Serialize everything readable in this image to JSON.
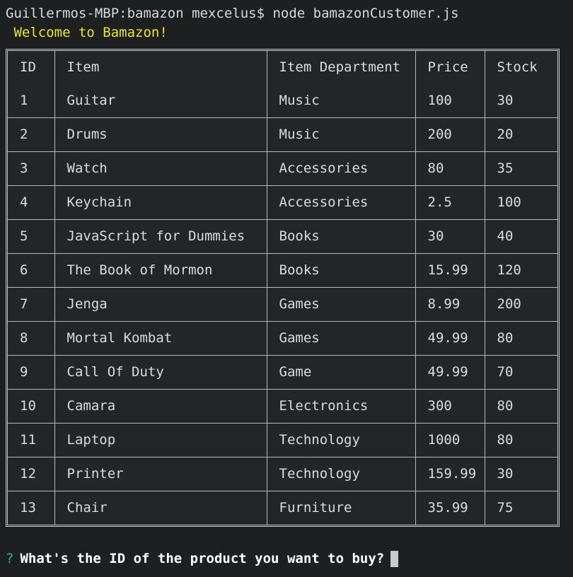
{
  "terminal": {
    "command_line": "Guillermos-MBP:bamazon mexcelus$ node bamazonCustomer.js",
    "welcome_message": " Welcome to Bamazon!",
    "prompt": {
      "marker": "?",
      "question": "What's the ID of the product you want to buy?",
      "input_value": "",
      "cursor": "block"
    },
    "colors": {
      "background": "#1d1f21",
      "foreground": "#d8d8d8",
      "welcome": "#e8e82c",
      "prompt_marker": "#2bbc8a",
      "prompt_text": "#ffffff",
      "table_border": "#b9b9b9",
      "cursor": "#c9c9c9"
    }
  },
  "table": {
    "columns": [
      "ID",
      "Item",
      "Item Department",
      "Price",
      "Stock"
    ],
    "rows": [
      [
        "1",
        "Guitar",
        "Music",
        "100",
        "30"
      ],
      [
        "2",
        "Drums",
        "Music",
        "200",
        "20"
      ],
      [
        "3",
        "Watch",
        "Accessories",
        "80",
        "35"
      ],
      [
        "4",
        "Keychain",
        "Accessories",
        "2.5",
        "100"
      ],
      [
        "5",
        "JavaScript for Dummies",
        "Books",
        "30",
        "40"
      ],
      [
        "6",
        "The Book of Mormon",
        "Books",
        "15.99",
        "120"
      ],
      [
        "7",
        "Jenga",
        "Games",
        "8.99",
        "200"
      ],
      [
        "8",
        "Mortal Kombat",
        "Games",
        "49.99",
        "80"
      ],
      [
        "9",
        "Call Of Duty",
        "Game",
        "49.99",
        "70"
      ],
      [
        "10",
        "Camara",
        "Electronics",
        "300",
        "80"
      ],
      [
        "11",
        "Laptop",
        "Technology",
        "1000",
        "80"
      ],
      [
        "12",
        "Printer",
        "Technology",
        "159.99",
        "30"
      ],
      [
        "13",
        "Chair",
        "Furniture",
        "35.99",
        "75"
      ]
    ]
  }
}
